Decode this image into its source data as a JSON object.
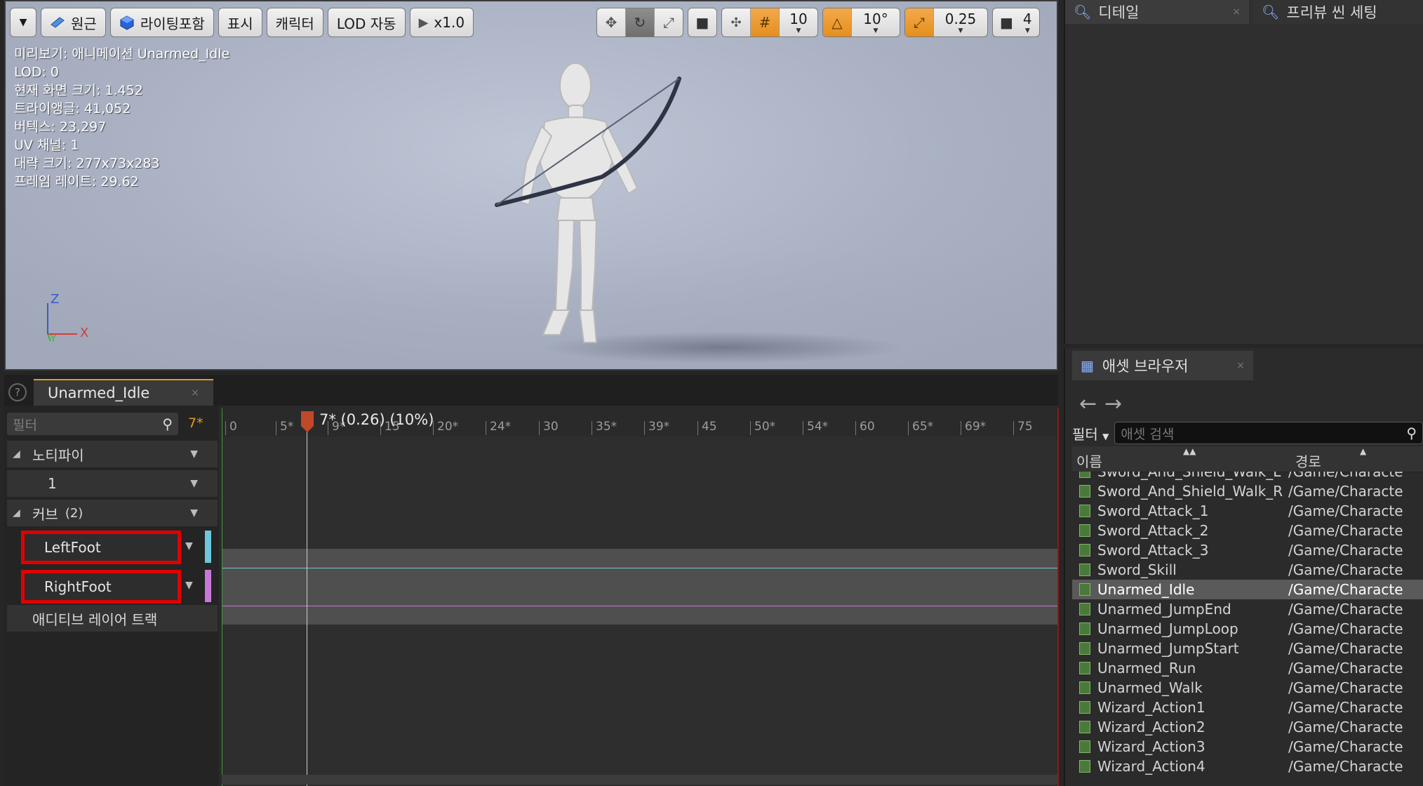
{
  "viewport": {
    "toolbar": {
      "perspective_label": "원근",
      "lighting_label": "라이팅포함",
      "show_label": "표시",
      "character_label": "캐릭터",
      "lod_label": "LOD 자동",
      "playback_label": "x1.0",
      "grid_snap_value": "10",
      "rotation_snap_value": "10°",
      "scale_snap_value": "0.25",
      "camera_speed_value": "4"
    },
    "stats": [
      "미리보기: 애니메이션 Unarmed_Idle",
      "LOD: 0",
      "현재 화면 크기: 1.452",
      "트라이앵글: 41,052",
      "버텍스: 23,297",
      "UV 채널: 1",
      "대략 크기: 277x73x283",
      "프레임 레이트: 29.62"
    ],
    "axis": {
      "z": "Z",
      "x": "X",
      "y": "Y"
    }
  },
  "details_panel": {
    "tabs": [
      {
        "label": "디테일",
        "icon": "details-icon"
      },
      {
        "label": "프리뷰 씬 세팅",
        "icon": "details-icon"
      }
    ]
  },
  "asset_browser": {
    "tab_label": "애셋 브라우저",
    "filter_label": "필터",
    "search_placeholder": "애셋 검색",
    "columns": {
      "name": "이름",
      "path": "경로"
    },
    "rows": [
      {
        "name": "Sword_And_Shield_Walk_L",
        "path": "/Game/Characte"
      },
      {
        "name": "Sword_And_Shield_Walk_R",
        "path": "/Game/Characte"
      },
      {
        "name": "Sword_Attack_1",
        "path": "/Game/Characte"
      },
      {
        "name": "Sword_Attack_2",
        "path": "/Game/Characte"
      },
      {
        "name": "Sword_Attack_3",
        "path": "/Game/Characte"
      },
      {
        "name": "Sword_Skill",
        "path": "/Game/Characte"
      },
      {
        "name": "Unarmed_Idle",
        "path": "/Game/Characte",
        "selected": true
      },
      {
        "name": "Unarmed_JumpEnd",
        "path": "/Game/Characte"
      },
      {
        "name": "Unarmed_JumpLoop",
        "path": "/Game/Characte"
      },
      {
        "name": "Unarmed_JumpStart",
        "path": "/Game/Characte"
      },
      {
        "name": "Unarmed_Run",
        "path": "/Game/Characte"
      },
      {
        "name": "Unarmed_Walk",
        "path": "/Game/Characte"
      },
      {
        "name": "Wizard_Action1",
        "path": "/Game/Characte"
      },
      {
        "name": "Wizard_Action2",
        "path": "/Game/Characte"
      },
      {
        "name": "Wizard_Action3",
        "path": "/Game/Characte"
      },
      {
        "name": "Wizard_Action4",
        "path": "/Game/Characte"
      }
    ]
  },
  "timeline": {
    "tab_label": "Unarmed_Idle",
    "filter_placeholder": "필터",
    "current_frame": "7*",
    "notify_header": "노티파이",
    "notify_track": "1",
    "curves_header": "커브",
    "curves_count": "(2)",
    "curves": [
      {
        "name": "LeftFoot",
        "color": "#6ec6dc"
      },
      {
        "name": "RightFoot",
        "color": "#c878d8"
      }
    ],
    "additive_track": "애디티브 레이어 트랙",
    "playhead_label": "7* (0.26) (10%)",
    "ruler_ticks": [
      "0",
      "5*",
      "9*",
      "15",
      "20*",
      "24*",
      "30",
      "35*",
      "39*",
      "45",
      "50*",
      "54*",
      "60",
      "65*",
      "69*",
      "75"
    ]
  },
  "colors": {
    "accent_orange": "#e39a1f",
    "highlight_red": "#e00000",
    "playhead": "#c0492a"
  }
}
